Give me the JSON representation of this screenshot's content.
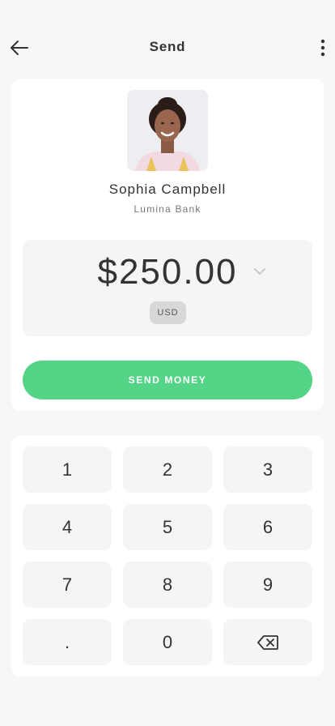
{
  "header": {
    "title": "Send",
    "back_icon": "arrow-left-icon",
    "more_icon": "more-vertical-icon"
  },
  "recipient": {
    "name": "Sophia Campbell",
    "bank": "Lumina Bank"
  },
  "amount": {
    "value": "$250.00",
    "currency": "USD"
  },
  "actions": {
    "send_label": "SEND MONEY"
  },
  "keypad": {
    "keys": [
      "1",
      "2",
      "3",
      "4",
      "5",
      "6",
      "7",
      "8",
      "9",
      ".",
      "0"
    ],
    "backspace_icon": "backspace-icon"
  },
  "colors": {
    "accent": "#53d487",
    "background": "#f7f7f7",
    "card": "#ffffff",
    "key_bg": "#f4f5f4"
  }
}
